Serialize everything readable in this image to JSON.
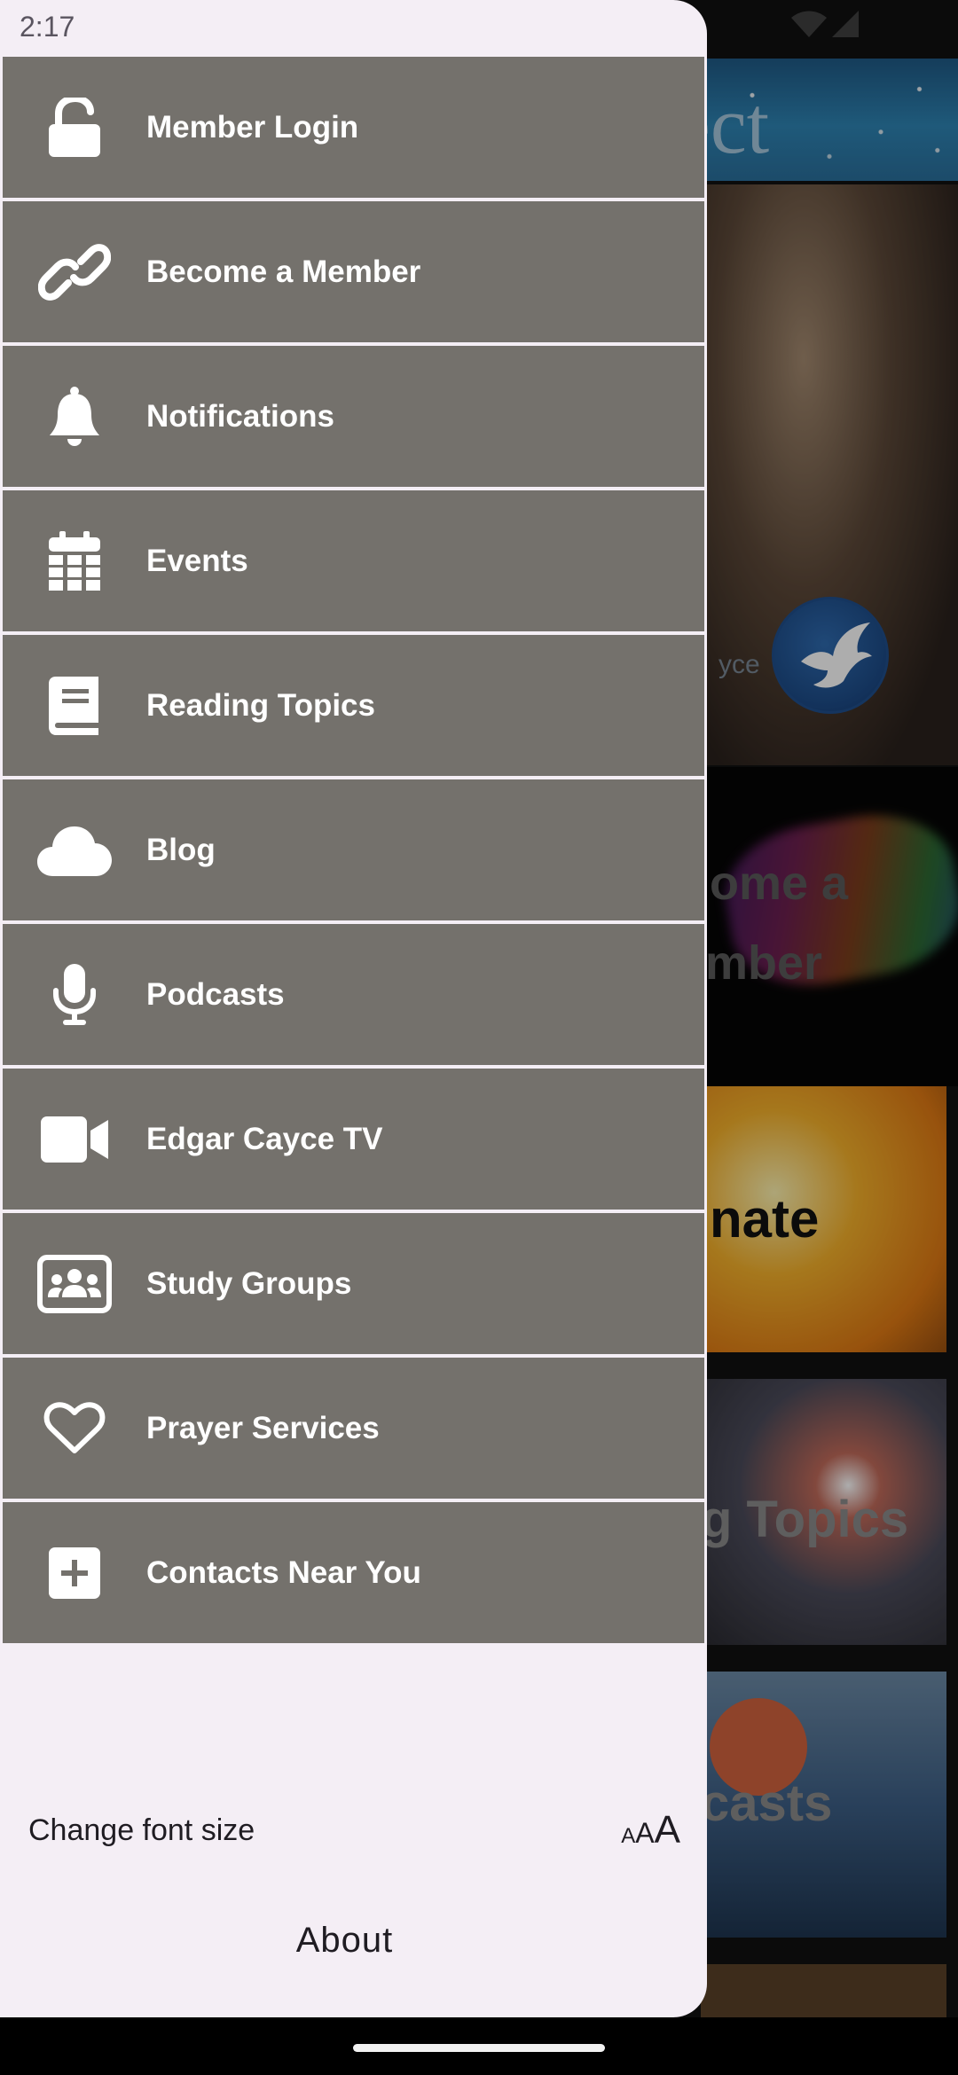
{
  "status_bar": {
    "time": "2:17",
    "wifi_icon": "wifi-icon",
    "signal_icon": "signal-icon"
  },
  "background_app": {
    "header_title": "ect",
    "hero_brand": "yce",
    "tiles": [
      {
        "line1": "ome a",
        "line2": "mber"
      },
      {
        "line1": "nate"
      },
      {
        "line1": "g Topics"
      },
      {
        "line1": "casts"
      }
    ]
  },
  "drawer": {
    "items": [
      {
        "label": "Member Login",
        "icon": "unlock-icon"
      },
      {
        "label": "Become a Member",
        "icon": "link-icon"
      },
      {
        "label": "Notifications",
        "icon": "bell-icon"
      },
      {
        "label": "Events",
        "icon": "calendar-icon"
      },
      {
        "label": "Reading Topics",
        "icon": "book-icon"
      },
      {
        "label": "Blog",
        "icon": "cloud-icon"
      },
      {
        "label": "Podcasts",
        "icon": "microphone-icon"
      },
      {
        "label": "Edgar Cayce TV",
        "icon": "video-camera-icon"
      },
      {
        "label": "Study Groups",
        "icon": "group-icon"
      },
      {
        "label": "Prayer Services",
        "icon": "heart-icon"
      },
      {
        "label": "Contacts Near You",
        "icon": "plus-square-icon"
      }
    ],
    "font_size_label": "Change font size",
    "font_size_icon": {
      "small": "A",
      "medium": "A",
      "large": "A"
    },
    "about_label": "About"
  },
  "colors": {
    "drawer_bg": "#f4eef5",
    "menu_item_bg": "#74716c",
    "menu_text": "#ffffff"
  }
}
